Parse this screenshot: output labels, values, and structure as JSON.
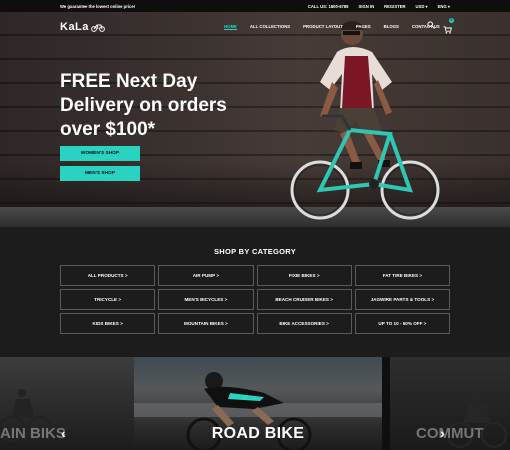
{
  "topbar": {
    "promo": "We guarantee the lowest online price!",
    "call_label": "CALL US:",
    "phone": "1800-6789",
    "sign_in": "SIGN IN",
    "register": "REGISTER",
    "currency": "USD",
    "language": "ENG"
  },
  "header": {
    "logo": "KaLa",
    "nav": [
      {
        "label": "HOME"
      },
      {
        "label": "ALL COLLECTIONS"
      },
      {
        "label": "PRODUCT LAYOUT"
      },
      {
        "label": "PAGES"
      },
      {
        "label": "BLOGS"
      },
      {
        "label": "CONTACT US"
      }
    ],
    "cart_count": "0"
  },
  "hero": {
    "headline": "FREE Next Day Delivery on orders over $100*",
    "womens_button": "WOMEN'S SHOP",
    "mens_button": "MEN'S SHOP"
  },
  "categories": {
    "title": "SHOP BY CATEGORY",
    "items": [
      "ALL PRODUCTS >",
      "AIR PUMP >",
      "FIXIE BIKES >",
      "FAT TIRE BIKES >",
      "TRICYCLE >",
      "MEN'S BICYCLES >",
      "BEACH CRUISER BIKES >",
      "JAGWIRE PARTS & TOOLS >",
      "KIDS BIKES >",
      "MOUNTAIN BIKES >",
      "BIKE ACCESSORIES >",
      "UP TO 10 - 50% OFF >"
    ]
  },
  "carousel": {
    "left_title": "AIN BIKS",
    "main_title": "ROAD BIKE",
    "right_title": "COMMUT",
    "prev": "‹",
    "next": "›"
  },
  "colors": {
    "accent": "#2ad2c1",
    "bg": "#1c1c1c"
  }
}
